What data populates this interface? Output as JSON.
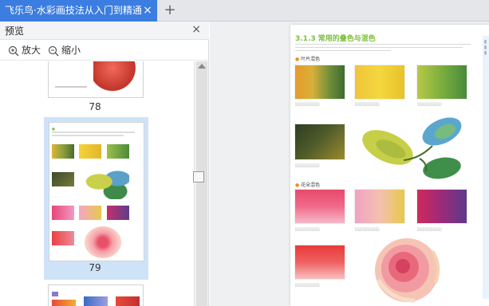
{
  "tab": {
    "title": "飞乐鸟·水彩画技法从入门到精通",
    "close": "×"
  },
  "new_tab": "+",
  "sidebar": {
    "title": "预览",
    "close": "×",
    "zoom_in": "放大",
    "zoom_out": "缩小",
    "pages": [
      {
        "num": "78"
      },
      {
        "num": "79"
      }
    ]
  },
  "page": {
    "title": "3.1.3 常用的叠色与混色",
    "sections": [
      {
        "label": "叶片混色"
      },
      {
        "label": "花朵混色"
      }
    ]
  },
  "colors": {
    "tab_accent": "#3b7de0",
    "selected_thumb": "#cfe3f8",
    "heading_green": "#7cbe3c"
  }
}
